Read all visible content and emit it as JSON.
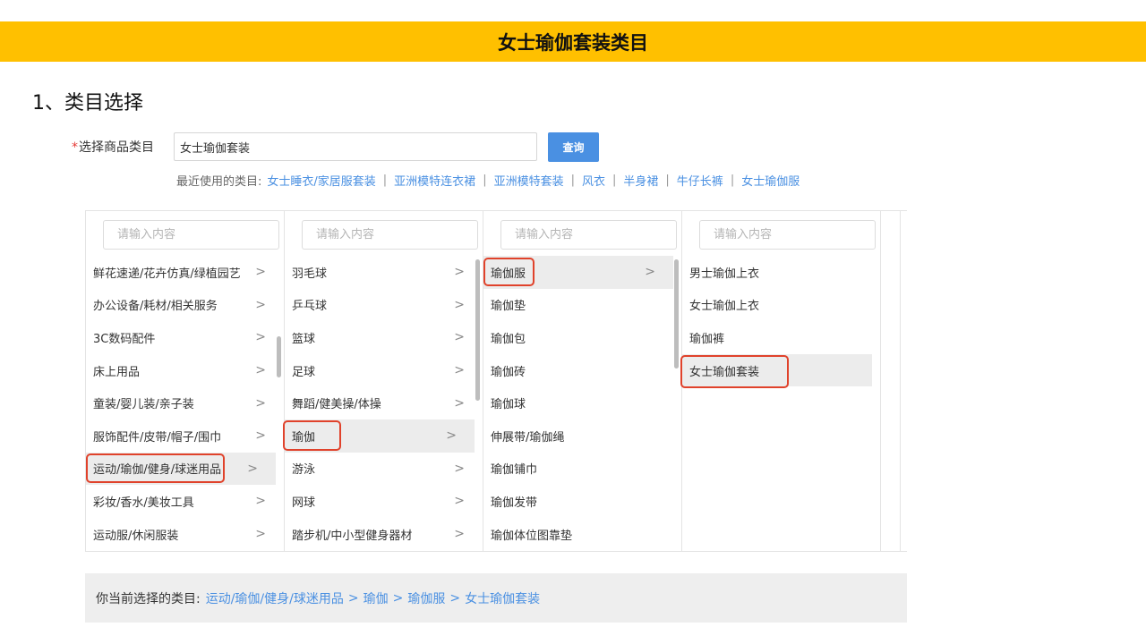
{
  "banner": {
    "title": "女士瑜伽套装类目"
  },
  "section": {
    "title": "1、类目选择"
  },
  "category_select": {
    "required_mark": "*",
    "label": "选择商品类目",
    "input_value": "女士瑜伽套装",
    "query_button": "查询"
  },
  "recent": {
    "label": "最近使用的类目:",
    "items": [
      "女士睡衣/家居服套装",
      "亚洲模特连衣裙",
      "亚洲模特套装",
      "风衣",
      "半身裙",
      "牛仔长裤",
      "女士瑜伽服"
    ],
    "separator": "|"
  },
  "columns": [
    {
      "search_placeholder": "请输入内容",
      "items": [
        "鲜花速递/花卉仿真/绿植园艺",
        "办公设备/耗材/相关服务",
        "3C数码配件",
        "床上用品",
        "童装/婴儿装/亲子装",
        "服饰配件/皮带/帽子/围巾",
        "运动/瑜伽/健身/球迷用品",
        "彩妆/香水/美妆工具",
        "运动服/休闲服装"
      ]
    },
    {
      "search_placeholder": "请输入内容",
      "items": [
        "羽毛球",
        "乒乓球",
        "篮球",
        "足球",
        "舞蹈/健美操/体操",
        "瑜伽",
        "游泳",
        "网球",
        "踏步机/中小型健身器材"
      ]
    },
    {
      "search_placeholder": "请输入内容",
      "items": [
        "瑜伽服",
        "瑜伽垫",
        "瑜伽包",
        "瑜伽砖",
        "瑜伽球",
        "伸展带/瑜伽绳",
        "瑜伽铺巾",
        "瑜伽发带",
        "瑜伽体位图靠垫"
      ]
    },
    {
      "search_placeholder": "请输入内容",
      "items": [
        "男士瑜伽上衣",
        "女士瑜伽上衣",
        "瑜伽裤",
        "女士瑜伽套装"
      ]
    }
  ],
  "chevron": ">",
  "current": {
    "label": "你当前选择的类目:",
    "path": [
      "运动/瑜伽/健身/球迷用品",
      "瑜伽",
      "瑜伽服",
      "女士瑜伽套装"
    ],
    "separator": ">"
  },
  "colors": {
    "banner": "#FFC000",
    "link": "#4A90E2",
    "highlight": "#E0422B",
    "button": "#4A90E2"
  }
}
